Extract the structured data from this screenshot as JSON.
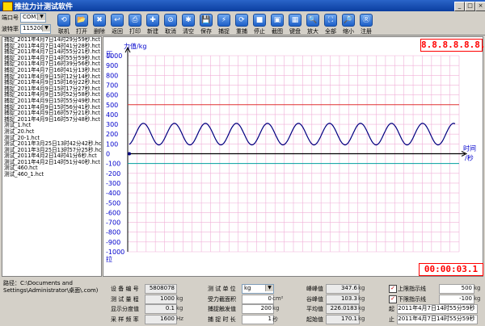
{
  "window": {
    "title": "推拉力计测试软件",
    "minimize": "_",
    "maximize": "□",
    "close": "×"
  },
  "toolbar": {
    "port_label": "端口号",
    "port_value": "COM1",
    "baud_label": "波特率",
    "baud_value": "115200",
    "buttons": [
      "联机",
      "打开",
      "删除",
      "返回",
      "打印",
      "新建",
      "取消",
      "清空",
      "保存",
      "捕捉",
      "重捕",
      "停止",
      "截图",
      "键盘",
      "放大",
      "全部",
      "缩小",
      "注册"
    ]
  },
  "files": [
    "捕捉_2011年4月7日14时29分59秒.hct",
    "捕捉_2011年4月7日14时41分28秒.hct",
    "捕捉_2011年4月7日14时55分21秒.hct",
    "捕捉_2011年4月7日14时55分59秒.hct",
    "捕捉_2011年4月7日16时39分56秒.hct",
    "捕捉_2011年4月7日16时41分13秒.hct",
    "捕捉_2011年4月9日15时12分14秒.hct",
    "捕捉_2011年4月9日15时16分22秒.hct",
    "捕捉_2011年4月9日15时17分27秒.hct",
    "捕捉_2011年4月9日15时52分58秒.hct",
    "捕捉_2011年4月9日15时55分49秒.hct",
    "捕捉_2011年4月9日15时56分41秒.hct",
    "捕捉_2011年4月9日16时57分21秒.hct",
    "捕捉_2011年4月9日16时57分48秒.hct",
    "测试_1.hct",
    "测试_20.hct",
    "测试_20-1.hct",
    "测试_2011年3月25日13时42分42秒.hct",
    "测试_2011年3月25日13时57分25秒.hct",
    "测试_2011年4月2日14时41分6秒.hct",
    "测试_2011年4月2日14时51分40秒.hct",
    "测试_460.hct",
    "测试_460_1.hct"
  ],
  "chart_data": {
    "type": "line",
    "ylabel": "力值/kg",
    "ylabel_top": "压",
    "ylabel_bottom": "拉",
    "xlabel": "时间",
    "xlabel_unit": "/秒",
    "ylim": [
      -1000,
      1000
    ],
    "yticks": [
      "1000",
      "900",
      "800",
      "700",
      "600",
      "500",
      "400",
      "300",
      "200",
      "100",
      "0",
      "-100",
      "-200",
      "-300",
      "-400",
      "-500",
      "-600",
      "-700",
      "-800",
      "-900",
      "-1000"
    ],
    "upper_limit": 500,
    "lower_limit": -100,
    "series": [
      {
        "cycles": 10.5,
        "center": 200,
        "amplitude": 110
      }
    ],
    "colors": {
      "grid": "#f0b0d8",
      "axis": "#000000",
      "series": "#000080",
      "upper": "#e03030",
      "lower": "#00a0a0",
      "labels": "#0000cc"
    }
  },
  "displays": {
    "peak_digits": "8.8.8.8.8.8.8",
    "timer": "00:00:03.1"
  },
  "path": {
    "text": "路径：C:\\Documents and Settings\\Administrator\\桌面\\.com)"
  },
  "status": {
    "device_no_label": "设 备 编 号",
    "device_no": "5808078",
    "range_label": "测 试 量 程",
    "range": "1000",
    "range_unit": "kg",
    "resolution_label": "显示分度值",
    "resolution": "0.1",
    "resolution_unit": "kg",
    "freq_label": "采 样 频 率",
    "freq": "1600",
    "freq_unit": "Hz",
    "unit_label": "测 试 单 位",
    "unit_value": "kg",
    "area_label": "受力截面积",
    "area": "0",
    "area_unit": "cm²",
    "trigger_label": "捕捉触发值",
    "trigger": "200",
    "trigger_unit": "kg",
    "duration_label": "捕 捉 时 长",
    "duration": "1",
    "duration_unit": "秒",
    "peak_label": "峰峰值",
    "peak": "347.6",
    "peak_unit": "kg",
    "valley_label": "谷峰值",
    "valley": "103.3",
    "valley_unit": "kg",
    "avg_label": "平均值",
    "avg": "226.0183",
    "avg_unit": "kg",
    "start_label": "起始值",
    "start": "170.1",
    "start_unit": "kg",
    "upper_label": "上限指示线",
    "upper": "500",
    "upper_unit": "kg",
    "lower_label": "下限指示线",
    "lower": "-100",
    "lower_unit": "kg",
    "time_start_label": "起",
    "time_start": "2011年4月7日14时55分59秒",
    "time_end_label": "止",
    "time_end": "2011年4月7日14时55分59秒",
    "check_mark": "✓"
  }
}
